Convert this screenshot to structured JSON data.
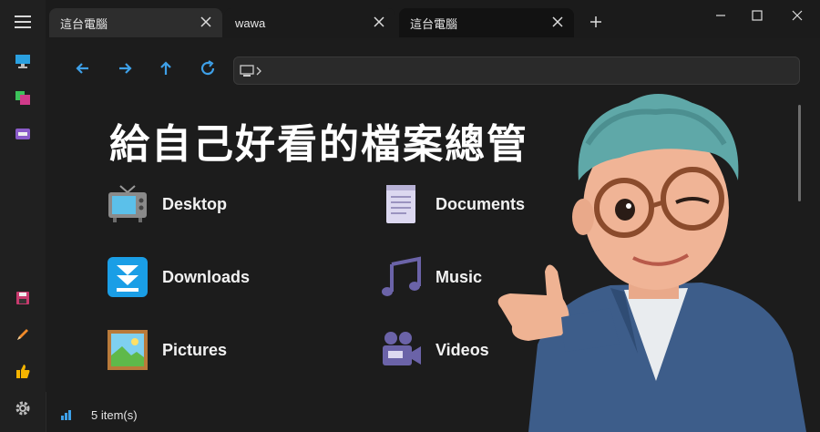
{
  "tabs": [
    {
      "label": "這台電腦"
    },
    {
      "label": "wawa"
    },
    {
      "label": "這台電腦"
    }
  ],
  "headline": "給自己好看的檔案總管",
  "folders": [
    {
      "label": "Desktop",
      "icon": "tv-icon"
    },
    {
      "label": "Documents",
      "icon": "notepad-icon"
    },
    {
      "label": "Downloads",
      "icon": "download-arrow-icon"
    },
    {
      "label": "Music",
      "icon": "music-notes-icon"
    },
    {
      "label": "Pictures",
      "icon": "landscape-picture-icon"
    },
    {
      "label": "Videos",
      "icon": "video-camera-icon"
    }
  ],
  "status": {
    "count": "5 item(s)"
  },
  "colors": {
    "accent": "#3ea0e8",
    "background": "#1c1c1c",
    "tab_inactive": "#2d2d2d",
    "tab_active": "#121212"
  }
}
